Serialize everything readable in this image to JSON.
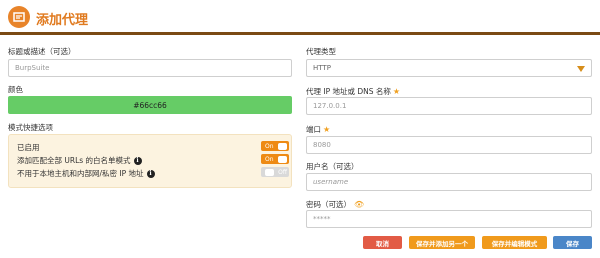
{
  "header": {
    "title": "添加代理",
    "icon": "proxy-logo-icon"
  },
  "left": {
    "label_name": "标题或描述（可选）",
    "name_placeholder": "BurpSuite",
    "label_color": "颜色",
    "color_value": "#66cc66",
    "label_mode": "模式快捷选项",
    "mode_options": [
      {
        "label": "已启用",
        "toggle": "On",
        "info": false
      },
      {
        "label": "添加匹配全部 URLs 的白名单模式",
        "toggle": "On",
        "info": true
      },
      {
        "label": "不用于本地主机和内部网/私密 IP 地址",
        "toggle": "Off",
        "info": true
      }
    ]
  },
  "right": {
    "label_type": "代理类型",
    "type_value": "HTTP",
    "label_ip": "代理 IP 地址或 DNS 名称",
    "ip_placeholder": "127.0.0.1",
    "label_port": "端口",
    "port_placeholder": "8080",
    "label_user": "用户名（可选）",
    "user_placeholder": "username",
    "label_password": "密码（可选）",
    "password_placeholder": "*****"
  },
  "buttons": {
    "cancel": "取消",
    "save_add": "保存并添加另一个",
    "save_edit": "保存并编辑模式",
    "save": "保存"
  },
  "colors": {
    "accent": "#e07a1f",
    "header_bar": "#7a4a14",
    "cancel": "#e25b45",
    "save": "#4a86c8",
    "toggle_on": "#ee8a13"
  }
}
